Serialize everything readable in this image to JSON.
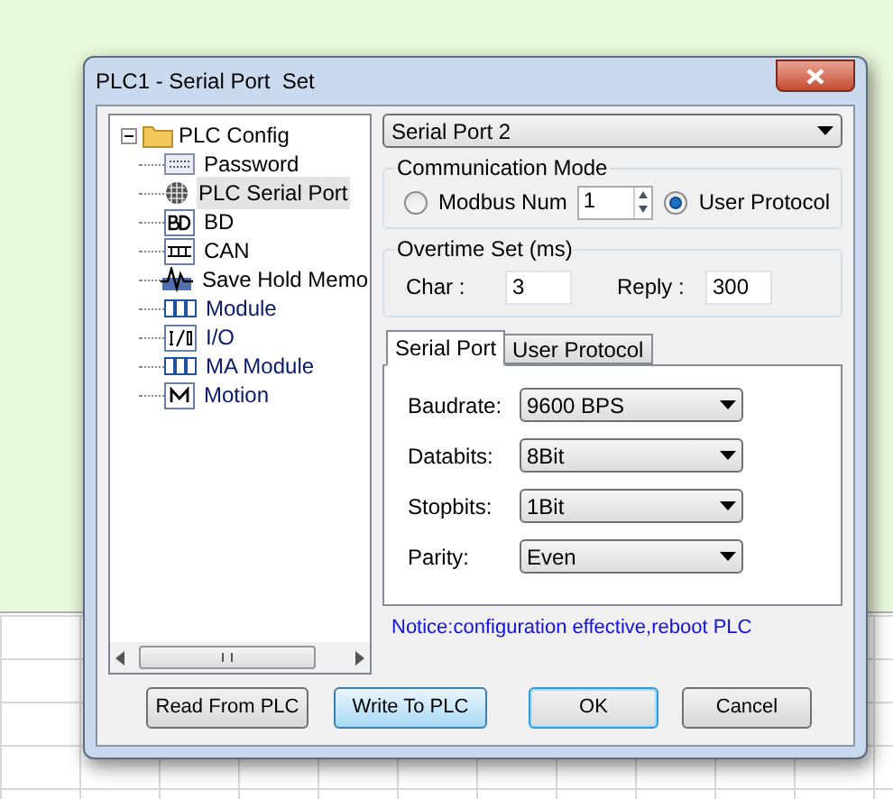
{
  "window": {
    "title": "PLC1 - Serial Port  Set"
  },
  "tree": {
    "label": "PLC Config",
    "expanded": true,
    "children": [
      {
        "label": "Password",
        "kind": "password",
        "selected": false
      },
      {
        "label": "PLC Serial Port",
        "kind": "port",
        "selected": true
      },
      {
        "label": "BD",
        "kind": "bd",
        "selected": false
      },
      {
        "label": "CAN",
        "kind": "can",
        "selected": false
      },
      {
        "label": "Save Hold Memo",
        "kind": "wave",
        "selected": false
      },
      {
        "label": "Module",
        "kind": "module",
        "selected": false
      },
      {
        "label": "I/O",
        "kind": "io",
        "selected": false
      },
      {
        "label": "MA Module",
        "kind": "module",
        "selected": false
      },
      {
        "label": "Motion",
        "kind": "motion",
        "selected": false
      }
    ]
  },
  "port_select": {
    "value": "Serial Port 2"
  },
  "communication_mode": {
    "title": "Communication Mode",
    "options": [
      {
        "label": "Modbus Num",
        "selected": false
      },
      {
        "label": "User Protocol",
        "selected": true
      }
    ],
    "modbus_num": "1"
  },
  "overtime": {
    "title": "Overtime Set (ms)",
    "char_label": "Char :",
    "char_value": "3",
    "reply_label": "Reply :",
    "reply_value": "300"
  },
  "tabs": [
    {
      "label": "Serial Port",
      "selected": true
    },
    {
      "label": "User Protocol",
      "selected": false
    }
  ],
  "settings": [
    {
      "label": "Baudrate:",
      "value": "9600 BPS"
    },
    {
      "label": "Databits:",
      "value": "8Bit"
    },
    {
      "label": "Stopbits:",
      "value": "1Bit"
    },
    {
      "label": "Parity:",
      "value": "Even"
    }
  ],
  "notice": "Notice:configuration effective,reboot PLC",
  "buttons": [
    {
      "label": "Read From PLC",
      "kind": "normal"
    },
    {
      "label": "Write To PLC",
      "kind": "hover"
    },
    {
      "label": "OK",
      "kind": "default"
    },
    {
      "label": "Cancel",
      "kind": "normal"
    }
  ]
}
